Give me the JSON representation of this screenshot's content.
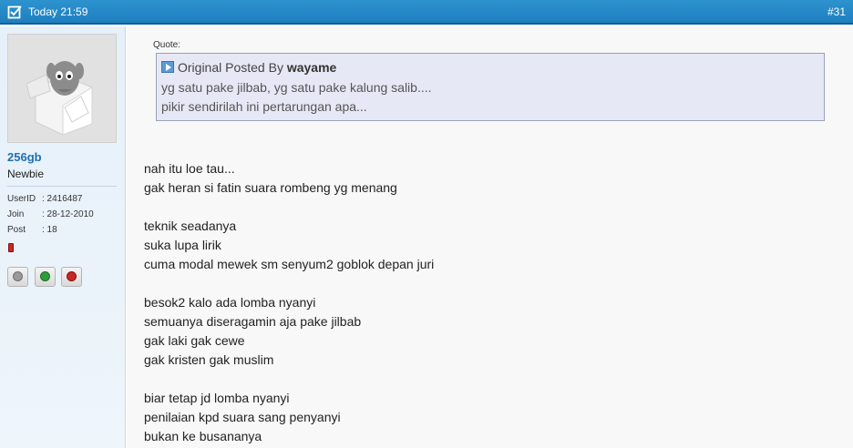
{
  "header": {
    "date": "Today 21:59",
    "post_number": "#31"
  },
  "user": {
    "username": "256gb",
    "rank": "Newbie",
    "stats": [
      {
        "label": "UserID",
        "value": ": 2416487"
      },
      {
        "label": "Join",
        "value": ": 28-12-2010"
      },
      {
        "label": "Post",
        "value": ": 18"
      }
    ],
    "actions": [
      {
        "icon": "offline-status-icon",
        "color": "#8a8a8a"
      },
      {
        "icon": "give-reputation-icon",
        "color": "#2e9e3a"
      },
      {
        "icon": "report-post-icon",
        "color": "#c62828"
      }
    ]
  },
  "quote": {
    "label": "Quote:",
    "prefix": "Original Posted By",
    "author": "wayame",
    "lines": [
      "yg satu pake jilbab, yg satu pake kalung salib....",
      "pikir sendirilah ini pertarungan apa..."
    ]
  },
  "message": {
    "lines": [
      "nah itu loe tau...",
      "gak heran si fatin suara rombeng yg menang",
      "teknik seadanya",
      "suka lupa lirik",
      "cuma modal mewek sm senyum2 goblok depan juri",
      "besok2 kalo ada lomba nyanyi",
      "semuanya diseragamin aja pake jilbab",
      "gak laki gak cewe",
      "gak kristen gak muslim",
      "biar tetap jd lomba nyanyi",
      "penilaian kpd suara sang penyanyi",
      "bukan ke busananya"
    ]
  },
  "colors": {
    "header_bg": "#2389c9",
    "username": "#1d6fb3",
    "quote_bg": "#e7e8f6"
  }
}
